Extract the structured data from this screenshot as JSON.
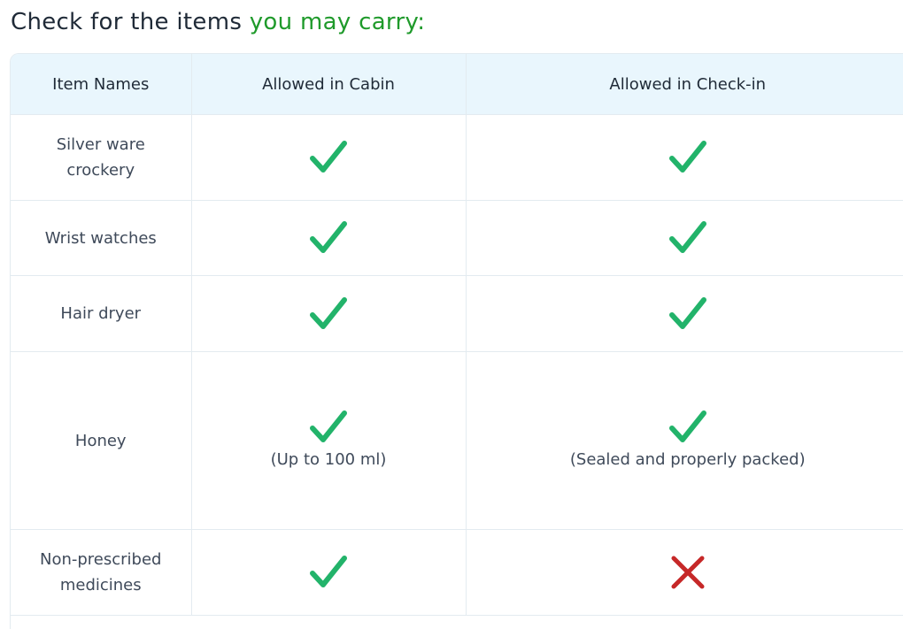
{
  "heading": {
    "main": "Check for the items ",
    "accent": "you may carry:"
  },
  "table": {
    "headers": [
      "Item Names",
      "Allowed in Cabin",
      "Allowed in Check-in"
    ],
    "rows": [
      {
        "item_line1": "Silver ware",
        "item_line2": "crockery",
        "cabin": "allowed",
        "checkin": "allowed"
      },
      {
        "item": "Wrist watches",
        "cabin": "allowed",
        "checkin": "allowed"
      },
      {
        "item": "Hair dryer",
        "cabin": "allowed",
        "checkin": "allowed"
      },
      {
        "item": "Honey",
        "cabin": "allowed",
        "cabin_note": "(Up to 100 ml)",
        "checkin": "allowed",
        "checkin_note": "(Sealed and properly packed)"
      },
      {
        "item_line1": "Non-prescribed",
        "item_line2": "medicines",
        "cabin": "allowed",
        "checkin": "not-allowed"
      }
    ]
  },
  "icons": {
    "allowed": "check-icon",
    "not_allowed": "cross-icon"
  },
  "colors": {
    "check": "#22b36a",
    "cross": "#c62828",
    "accent_text": "#1f9a2b",
    "header_bg": "#e9f6fd"
  }
}
